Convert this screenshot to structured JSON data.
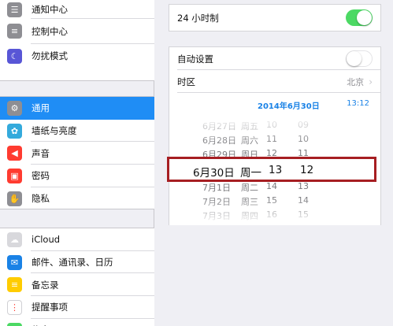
{
  "sidebar": {
    "group1": [
      {
        "label": "通知中心",
        "icon": "notification-center-icon",
        "color": "#8e8e93",
        "glyph": "☰"
      },
      {
        "label": "控制中心",
        "icon": "control-center-icon",
        "color": "#8e8e93",
        "glyph": "≡"
      },
      {
        "label": "勿扰模式",
        "icon": "moon-icon",
        "color": "#5856d6",
        "glyph": "☾"
      }
    ],
    "group2": [
      {
        "label": "通用",
        "icon": "gear-icon",
        "color": "#8e8e93",
        "glyph": "⚙",
        "selected": true
      },
      {
        "label": "墙纸与亮度",
        "icon": "flower-icon",
        "color": "#34aadc",
        "glyph": "✿"
      },
      {
        "label": "声音",
        "icon": "speaker-icon",
        "color": "#ff3b30",
        "glyph": "◀"
      },
      {
        "label": "密码",
        "icon": "lock-icon",
        "color": "#ff3b30",
        "glyph": "▣"
      },
      {
        "label": "隐私",
        "icon": "hand-icon",
        "color": "#8e8e93",
        "glyph": "✋"
      }
    ],
    "group3": [
      {
        "label": "iCloud",
        "icon": "cloud-icon",
        "color": "#d8d8dc",
        "glyph": "☁"
      },
      {
        "label": "邮件、通讯录、日历",
        "icon": "mail-icon",
        "color": "#1a82e6",
        "glyph": "✉"
      },
      {
        "label": "备忘录",
        "icon": "notes-icon",
        "color": "#ffcc00",
        "glyph": "≡"
      },
      {
        "label": "提醒事项",
        "icon": "reminders-icon",
        "color": "#ffffff",
        "glyph": "⋮"
      },
      {
        "label": "信息",
        "icon": "messages-icon",
        "color": "#4cd964",
        "glyph": "●"
      }
    ]
  },
  "detail": {
    "hour24_label": "24 小时制",
    "hour24_on": true,
    "auto_label": "自动设置",
    "auto_on": false,
    "timezone_label": "时区",
    "timezone_value": "北京",
    "chevron": "›",
    "date_header": "2014年6月30日",
    "time_header": "13:12"
  },
  "picker": {
    "above": [
      [
        "6月27日",
        "周五",
        "10",
        "09"
      ],
      [
        "6月28日",
        "周六",
        "11",
        "10"
      ],
      [
        "6月29日",
        "周日",
        "12",
        "11"
      ]
    ],
    "selected": [
      "6月30日",
      "周一",
      "13",
      "12"
    ],
    "below": [
      [
        "7月1日",
        "周二",
        "14",
        "13"
      ],
      [
        "7月2日",
        "周三",
        "15",
        "14"
      ],
      [
        "7月3日",
        "周四",
        "16",
        "15"
      ]
    ]
  },
  "highlight_color": "#a61e22",
  "accent_color": "#1f8df5"
}
